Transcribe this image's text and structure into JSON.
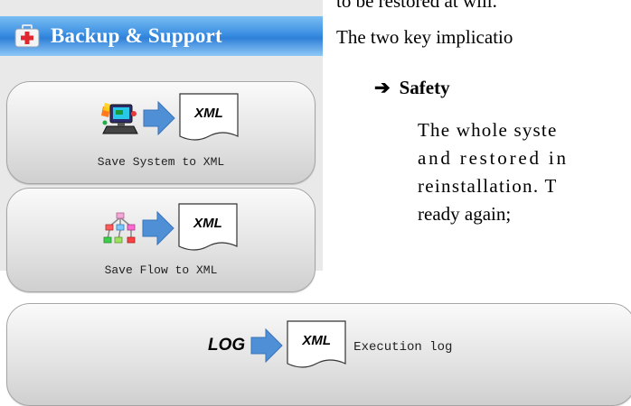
{
  "panel": {
    "title": "Backup & Support",
    "header_icon": "first-aid-kit-icon"
  },
  "buttons": {
    "save_system": {
      "label": "Save System to XML",
      "icon": "computer-icon",
      "doc_text": "XML"
    },
    "save_flow": {
      "label": "Save Flow to XML",
      "icon": "flowchart-icon",
      "doc_text": "XML"
    },
    "execution_log": {
      "label": "Execution log",
      "prefix": "LOG",
      "doc_text": "XML"
    }
  },
  "document": {
    "line_top": "to be restored at will.",
    "line_implications": "The two key implicatio",
    "bullet_arrow": "➔",
    "bullet_title": "Safety",
    "para_lines": [
      "The whole syste",
      "and restored in",
      "reinstallation. T",
      "ready again;"
    ]
  },
  "colors": {
    "header_gradient_top": "#79bdf3",
    "header_gradient_mid": "#2f80d8",
    "arrow_blue": "#4f8fd6",
    "panel_bg": "#e9e9e9"
  }
}
